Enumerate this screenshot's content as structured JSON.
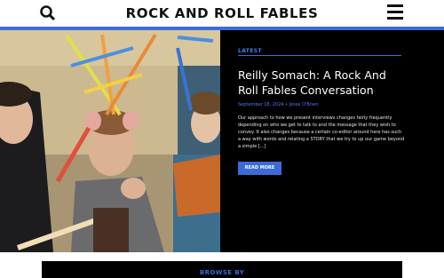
{
  "site": {
    "title": "ROCK AND ROLL FABLES"
  },
  "icons": {
    "search": "search-icon",
    "menu": "hamburger-menu-icon"
  },
  "colors": {
    "accent": "#3b6bd9",
    "accent_text": "#4d7cf0",
    "background": "#000000"
  },
  "featured": {
    "category": "LATEST",
    "title": "Reilly Somach: A Rock And Roll Fables Conversation",
    "date": "September 18, 2024",
    "author": "Jesse O'Brien",
    "excerpt": "Our approach to how we present interviews changes fairly frequently depending on who we get to talk to and the message that they wish to convey. It also changes because a certain co-editor around here has such a way with words and relating a STORY that we try to up our game beyond a simple [...]",
    "read_more": "READ MORE"
  },
  "browse": {
    "label": "BROWSE BY"
  }
}
